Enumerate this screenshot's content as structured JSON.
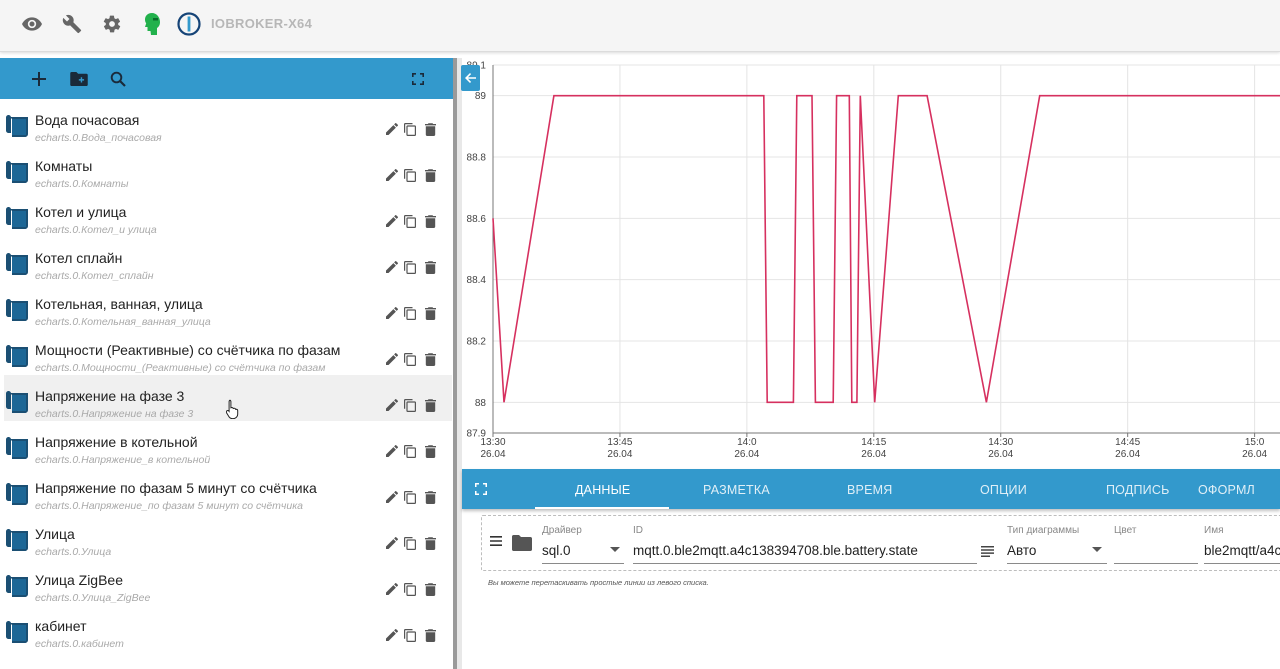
{
  "app": {
    "title": "IOBROKER-X64"
  },
  "toolbar_icons": [
    "eye-icon",
    "wrench-icon",
    "gear-icon",
    "user-avatar-icon",
    "iobroker-logo"
  ],
  "left_toolbar": {
    "icons": [
      "add-icon",
      "add-folder-icon",
      "search-icon",
      "fullscreen-icon"
    ]
  },
  "presets": [
    {
      "title": "Вода почасовая",
      "id": "echarts.0.Вода_почасовая"
    },
    {
      "title": "Комнаты",
      "id": "echarts.0.Комнаты"
    },
    {
      "title": "Котел и улица",
      "id": "echarts.0.Котел_и улица"
    },
    {
      "title": "Котел сплайн",
      "id": "echarts.0.Котел_сплайн"
    },
    {
      "title": "Котельная, ванная, улица",
      "id": "echarts.0.Котельная_ванная_улица"
    },
    {
      "title": "Мощности (Реактивные) со счётчика по фазам",
      "id": "echarts.0.Мощности_(Реактивные) со счётчика по фазам"
    },
    {
      "title": "Напряжение на фазе 3",
      "id": "echarts.0.Напряжение на фазе 3"
    },
    {
      "title": "Напряжение в котельной",
      "id": "echarts.0.Напряжение_в котельной"
    },
    {
      "title": "Напряжение по фазам 5 минут со счётчика",
      "id": "echarts.0.Напряжение_по фазам 5 минут со счётчика"
    },
    {
      "title": "Улица",
      "id": "echarts.0.Улица"
    },
    {
      "title": "Улица ZigBee",
      "id": "echarts.0.Улица_ZigBee"
    },
    {
      "title": "кабинет",
      "id": "echarts.0.кабинет"
    }
  ],
  "active_preset_index": 6,
  "tabs": [
    "ДАННЫЕ",
    "РАЗМЕТКА",
    "ВРЕМЯ",
    "ОПЦИИ",
    "ПОДПИСЬ",
    "ОФОРМЛ"
  ],
  "active_tab_index": 0,
  "line": {
    "driver_label": "Драйвер",
    "driver_value": "sql.0",
    "id_label": "ID",
    "id_value": "mqtt.0.ble2mqtt.a4c138394708.ble.battery.state",
    "chart_type_label": "Тип диаграммы",
    "chart_type_value": "Авто",
    "color_label": "Цвет",
    "color_value": "",
    "name_label": "Имя",
    "name_value": "ble2mqtt/a4c"
  },
  "hint": "Вы можете перетаскивать простые линии из левого списка.",
  "colors": {
    "accent": "#3399cc",
    "series": "#d6305f",
    "avatar": "#22b14c"
  },
  "chart_data": {
    "type": "line",
    "title": "",
    "xlabel": "",
    "ylabel": "",
    "ylim": [
      87.9,
      89.1
    ],
    "y_ticks": [
      "89.1",
      "89",
      "88.8",
      "88.6",
      "88.4",
      "88.2",
      "88",
      "87.9"
    ],
    "x_ticks": [
      {
        "time": "13:30",
        "date": "26.04",
        "t": 0
      },
      {
        "time": "13:45",
        "date": "26.04",
        "t": 15
      },
      {
        "time": "14:0",
        "date": "26.04",
        "t": 30
      },
      {
        "time": "14:15",
        "date": "26.04",
        "t": 45
      },
      {
        "time": "14:30",
        "date": "26.04",
        "t": 60
      },
      {
        "time": "14:45",
        "date": "26.04",
        "t": 75
      },
      {
        "time": "15:0",
        "date": "26.04",
        "t": 90
      }
    ],
    "grid": true,
    "series": [
      {
        "x": [
          0,
          1.3,
          7.2,
          32.0,
          32.4,
          35.5,
          35.9,
          37.7,
          38.1,
          40.2,
          40.6,
          42.1,
          42.4,
          43.0,
          43.4,
          45.1,
          47.9,
          51.3,
          58.3,
          64.6,
          93.0
        ],
        "y": [
          88.6,
          88.0,
          89.0,
          89.0,
          88.0,
          88.0,
          89.0,
          89.0,
          88.0,
          88.0,
          89.0,
          89.0,
          88.0,
          88.0,
          89.0,
          88.0,
          89.0,
          89.0,
          88.0,
          89.0,
          89.0
        ]
      }
    ]
  }
}
